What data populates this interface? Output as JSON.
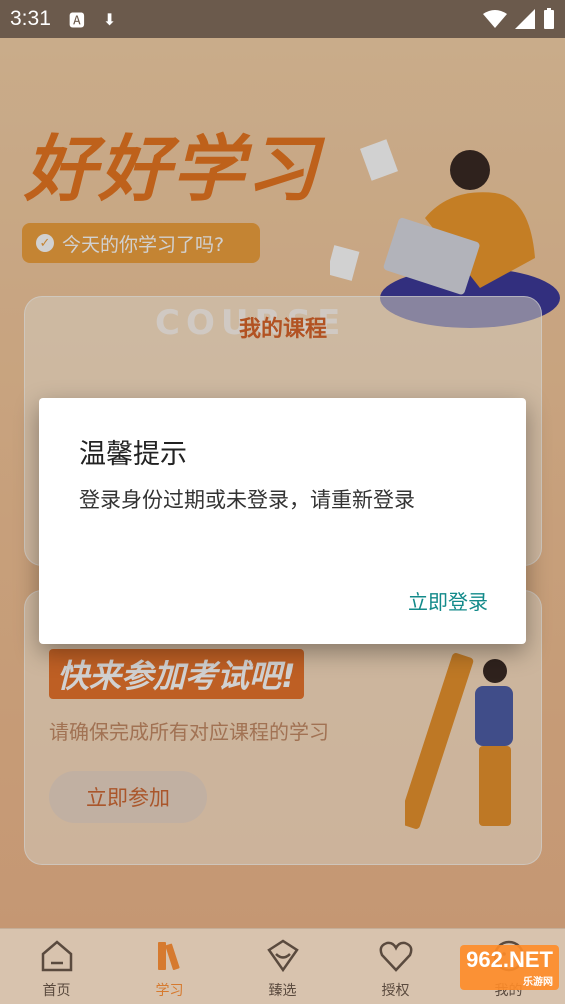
{
  "status_bar": {
    "time": "3:31"
  },
  "hero": {
    "title": "好好学习",
    "chip_text": "今天的你学习了吗?"
  },
  "course_card": {
    "watermark": "COURSE",
    "heading": "我的课程"
  },
  "exam_card": {
    "title": "快来参加考试吧!",
    "subtitle": "请确保完成所有对应课程的学习",
    "join_button": "立即参加"
  },
  "dialog": {
    "title": "温馨提示",
    "message": "登录身份过期或未登录，请重新登录",
    "action": "立即登录"
  },
  "bottom_nav": {
    "items": [
      {
        "label": "首页",
        "icon": "home-icon",
        "active": false
      },
      {
        "label": "学习",
        "icon": "books-icon",
        "active": true
      },
      {
        "label": "臻选",
        "icon": "select-icon",
        "active": false
      },
      {
        "label": "授权",
        "icon": "heart-icon",
        "active": false
      },
      {
        "label": "我的",
        "icon": "profile-icon",
        "active": false
      }
    ]
  },
  "watermark_badge": {
    "main": "962.NET",
    "sub": "乐游网"
  },
  "colors": {
    "accent": "#e87722",
    "dialog_action": "#138a8a",
    "nav_active": "#d67a2f"
  }
}
